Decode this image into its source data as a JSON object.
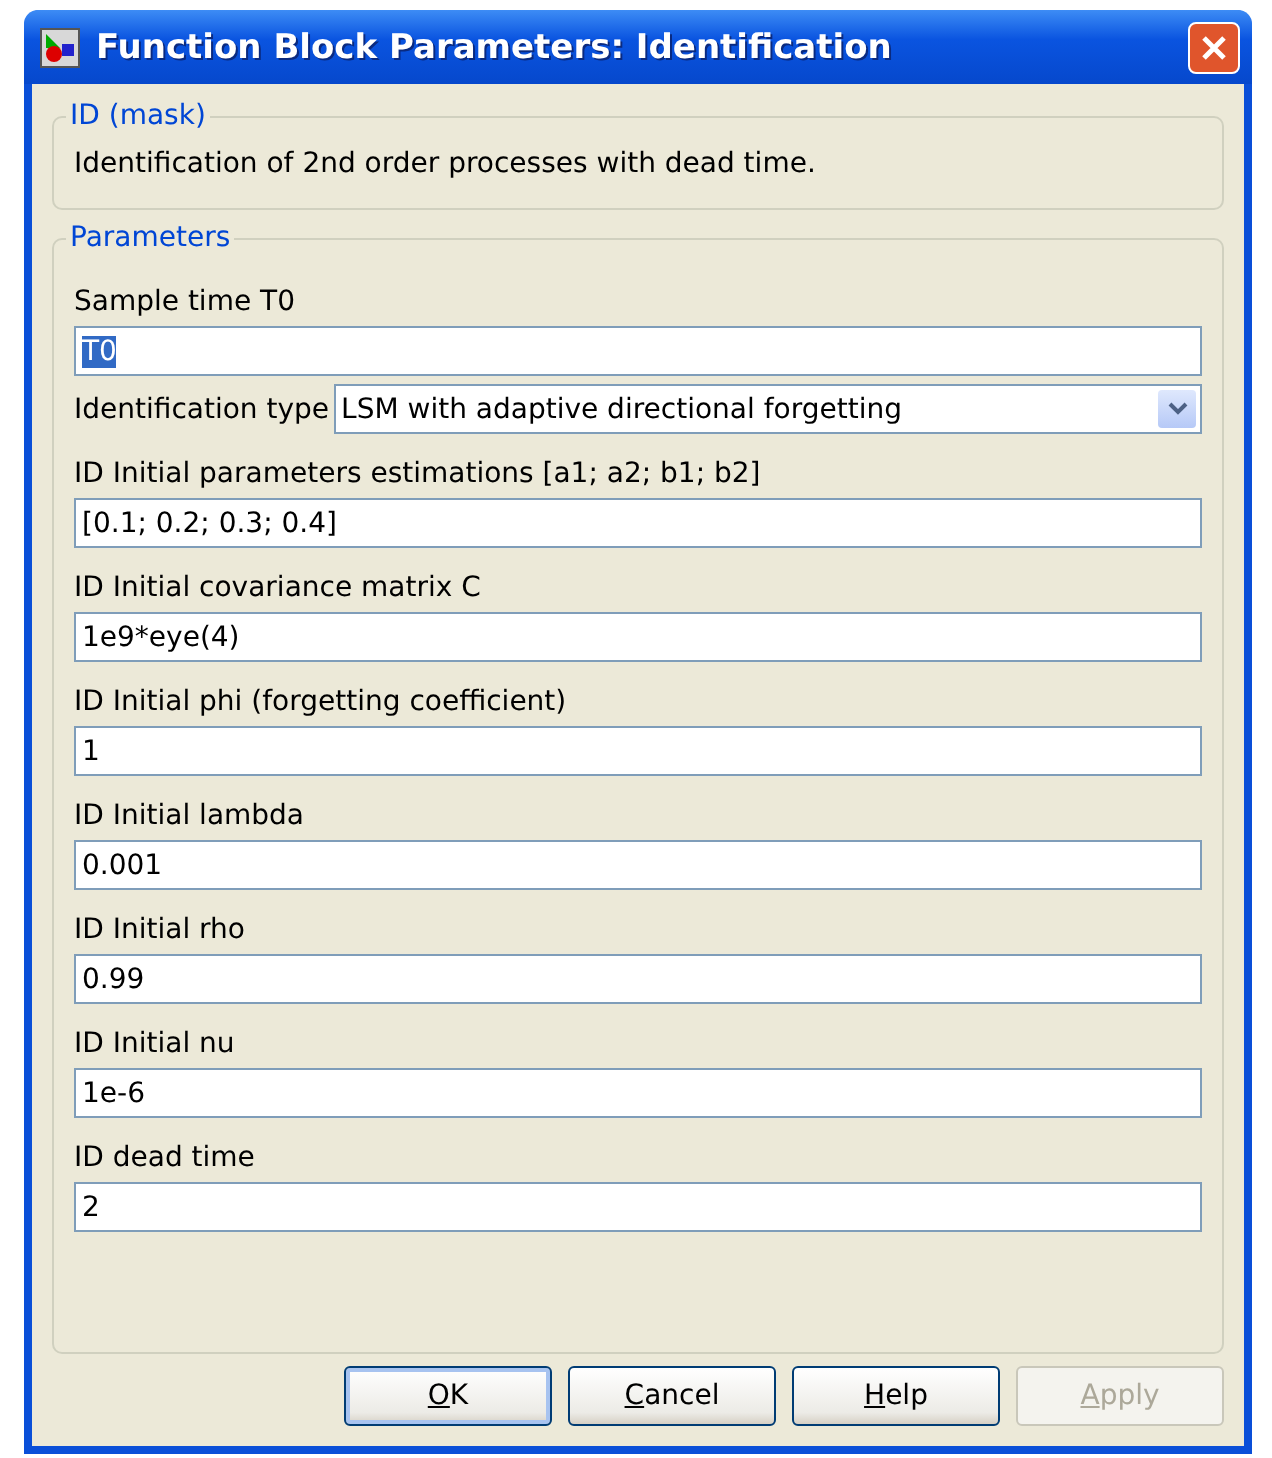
{
  "window": {
    "title": "Function Block Parameters: Identification"
  },
  "mask_group": {
    "title": "ID (mask)",
    "description": "Identification of 2nd order processes with dead time."
  },
  "parameters_group": {
    "title": "Parameters",
    "fields": [
      {
        "kind": "text",
        "label": "Sample time T0",
        "value": "T0",
        "highlighted": true
      },
      {
        "kind": "dropdown",
        "label": "Identification type",
        "value": "LSM with adaptive directional forgetting"
      },
      {
        "kind": "text",
        "label": "ID Initial parameters estimations [a1; a2; b1; b2]",
        "value": "[0.1; 0.2; 0.3; 0.4]",
        "highlighted": false
      },
      {
        "kind": "text",
        "label": "ID Initial covariance matrix C",
        "value": "1e9*eye(4)",
        "highlighted": false
      },
      {
        "kind": "text",
        "label": "ID Initial phi (forgetting coefficient)",
        "value": "1",
        "highlighted": false
      },
      {
        "kind": "text",
        "label": "ID Initial lambda",
        "value": "0.001",
        "highlighted": false
      },
      {
        "kind": "text",
        "label": "ID Initial rho",
        "value": "0.99",
        "highlighted": false
      },
      {
        "kind": "text",
        "label": "ID Initial nu",
        "value": "1e-6",
        "highlighted": false
      },
      {
        "kind": "text",
        "label": "ID dead time",
        "value": "2",
        "highlighted": false
      }
    ]
  },
  "buttons": [
    {
      "mnemonic": "O",
      "rest": "K",
      "default": true,
      "disabled": false
    },
    {
      "mnemonic": "C",
      "rest": "ancel",
      "default": false,
      "disabled": false
    },
    {
      "mnemonic": "H",
      "rest": "elp",
      "default": false,
      "disabled": false
    },
    {
      "mnemonic": "A",
      "rest": "pply",
      "default": false,
      "disabled": true
    }
  ]
}
